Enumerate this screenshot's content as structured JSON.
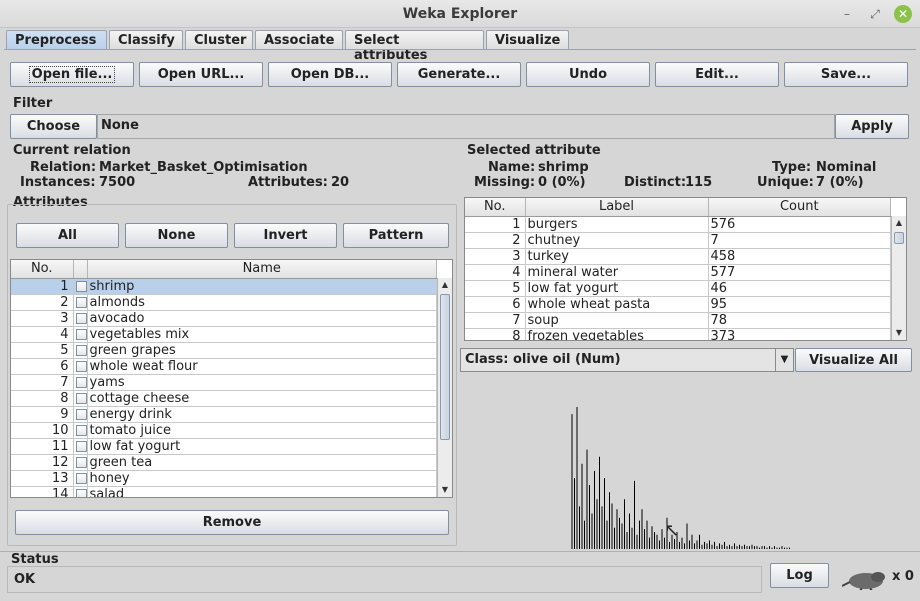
{
  "window": {
    "title": "Weka Explorer"
  },
  "tabs": [
    "Preprocess",
    "Classify",
    "Cluster",
    "Associate",
    "Select attributes",
    "Visualize"
  ],
  "toolbar": {
    "open_file": "Open file...",
    "open_url": "Open URL...",
    "open_db": "Open DB...",
    "generate": "Generate...",
    "undo": "Undo",
    "edit": "Edit...",
    "save": "Save..."
  },
  "filter": {
    "label": "Filter",
    "choose": "Choose",
    "value": "None",
    "apply": "Apply"
  },
  "current_relation": {
    "label": "Current relation",
    "relation_label": "Relation:",
    "relation": "Market_Basket_Optimisation",
    "instances_label": "Instances:",
    "instances": "7500",
    "attributes_label": "Attributes:",
    "attributes": "20"
  },
  "attributes": {
    "label": "Attributes",
    "all": "All",
    "none": "None",
    "invert": "Invert",
    "pattern": "Pattern",
    "col_no": "No.",
    "col_name": "Name",
    "rows": [
      {
        "no": "1",
        "name": "shrimp"
      },
      {
        "no": "2",
        "name": "almonds"
      },
      {
        "no": "3",
        "name": "avocado"
      },
      {
        "no": "4",
        "name": "vegetables mix"
      },
      {
        "no": "5",
        "name": "green grapes"
      },
      {
        "no": "6",
        "name": "whole weat flour"
      },
      {
        "no": "7",
        "name": "yams"
      },
      {
        "no": "8",
        "name": "cottage cheese"
      },
      {
        "no": "9",
        "name": "energy drink"
      },
      {
        "no": "10",
        "name": "tomato juice"
      },
      {
        "no": "11",
        "name": "low fat yogurt"
      },
      {
        "no": "12",
        "name": "green tea"
      },
      {
        "no": "13",
        "name": "honey"
      },
      {
        "no": "14",
        "name": "salad"
      }
    ],
    "remove": "Remove"
  },
  "selected_attribute": {
    "label": "Selected attribute",
    "name_label": "Name:",
    "name": "shrimp",
    "type_label": "Type:",
    "type": "Nominal",
    "missing_label": "Missing:",
    "missing": "0 (0%)",
    "distinct_label": "Distinct:",
    "distinct": "115",
    "unique_label": "Unique:",
    "unique": "7 (0%)",
    "col_no": "No.",
    "col_label": "Label",
    "col_count": "Count",
    "rows": [
      {
        "no": "1",
        "label": "burgers",
        "count": "576"
      },
      {
        "no": "2",
        "label": "chutney",
        "count": "7"
      },
      {
        "no": "3",
        "label": "turkey",
        "count": "458"
      },
      {
        "no": "4",
        "label": "mineral water",
        "count": "577"
      },
      {
        "no": "5",
        "label": "low fat yogurt",
        "count": "46"
      },
      {
        "no": "6",
        "label": "whole wheat pasta",
        "count": "95"
      },
      {
        "no": "7",
        "label": "soup",
        "count": "78"
      },
      {
        "no": "8",
        "label": "frozen vegetables",
        "count": "373"
      }
    ]
  },
  "class_selector": {
    "value": "Class: olive oil (Num)",
    "visualize_all": "Visualize All"
  },
  "histogram": {
    "bar_color": "#000000",
    "bars": [
      0.95,
      0.5,
      1.0,
      0.3,
      0.6,
      0.2,
      0.7,
      0.45,
      0.25,
      0.55,
      0.35,
      0.65,
      0.3,
      0.5,
      0.2,
      0.4,
      0.32,
      0.15,
      0.28,
      0.22,
      0.18,
      0.35,
      0.12,
      0.25,
      0.15,
      0.48,
      0.1,
      0.2,
      0.28,
      0.14,
      0.2,
      0.08,
      0.16,
      0.12,
      0.1,
      0.06,
      0.14,
      0.08,
      0.22,
      0.05,
      0.1,
      0.07,
      0.12,
      0.05,
      0.08,
      0.04,
      0.18,
      0.06,
      0.1,
      0.04,
      0.06,
      0.1,
      0.03,
      0.05,
      0.04,
      0.06,
      0.03,
      0.05,
      0.02,
      0.04,
      0.03,
      0.05,
      0.02,
      0.03,
      0.02,
      0.04,
      0.02,
      0.03,
      0.02,
      0.03,
      0.02,
      0.02,
      0.03,
      0.02,
      0.02,
      0.01,
      0.02,
      0.02,
      0.01,
      0.02,
      0.01,
      0.02,
      0.01,
      0.01,
      0.02,
      0.01,
      0.01,
      0.01
    ]
  },
  "status": {
    "label": "Status",
    "value": "OK",
    "log": "Log",
    "count": "x 0"
  }
}
